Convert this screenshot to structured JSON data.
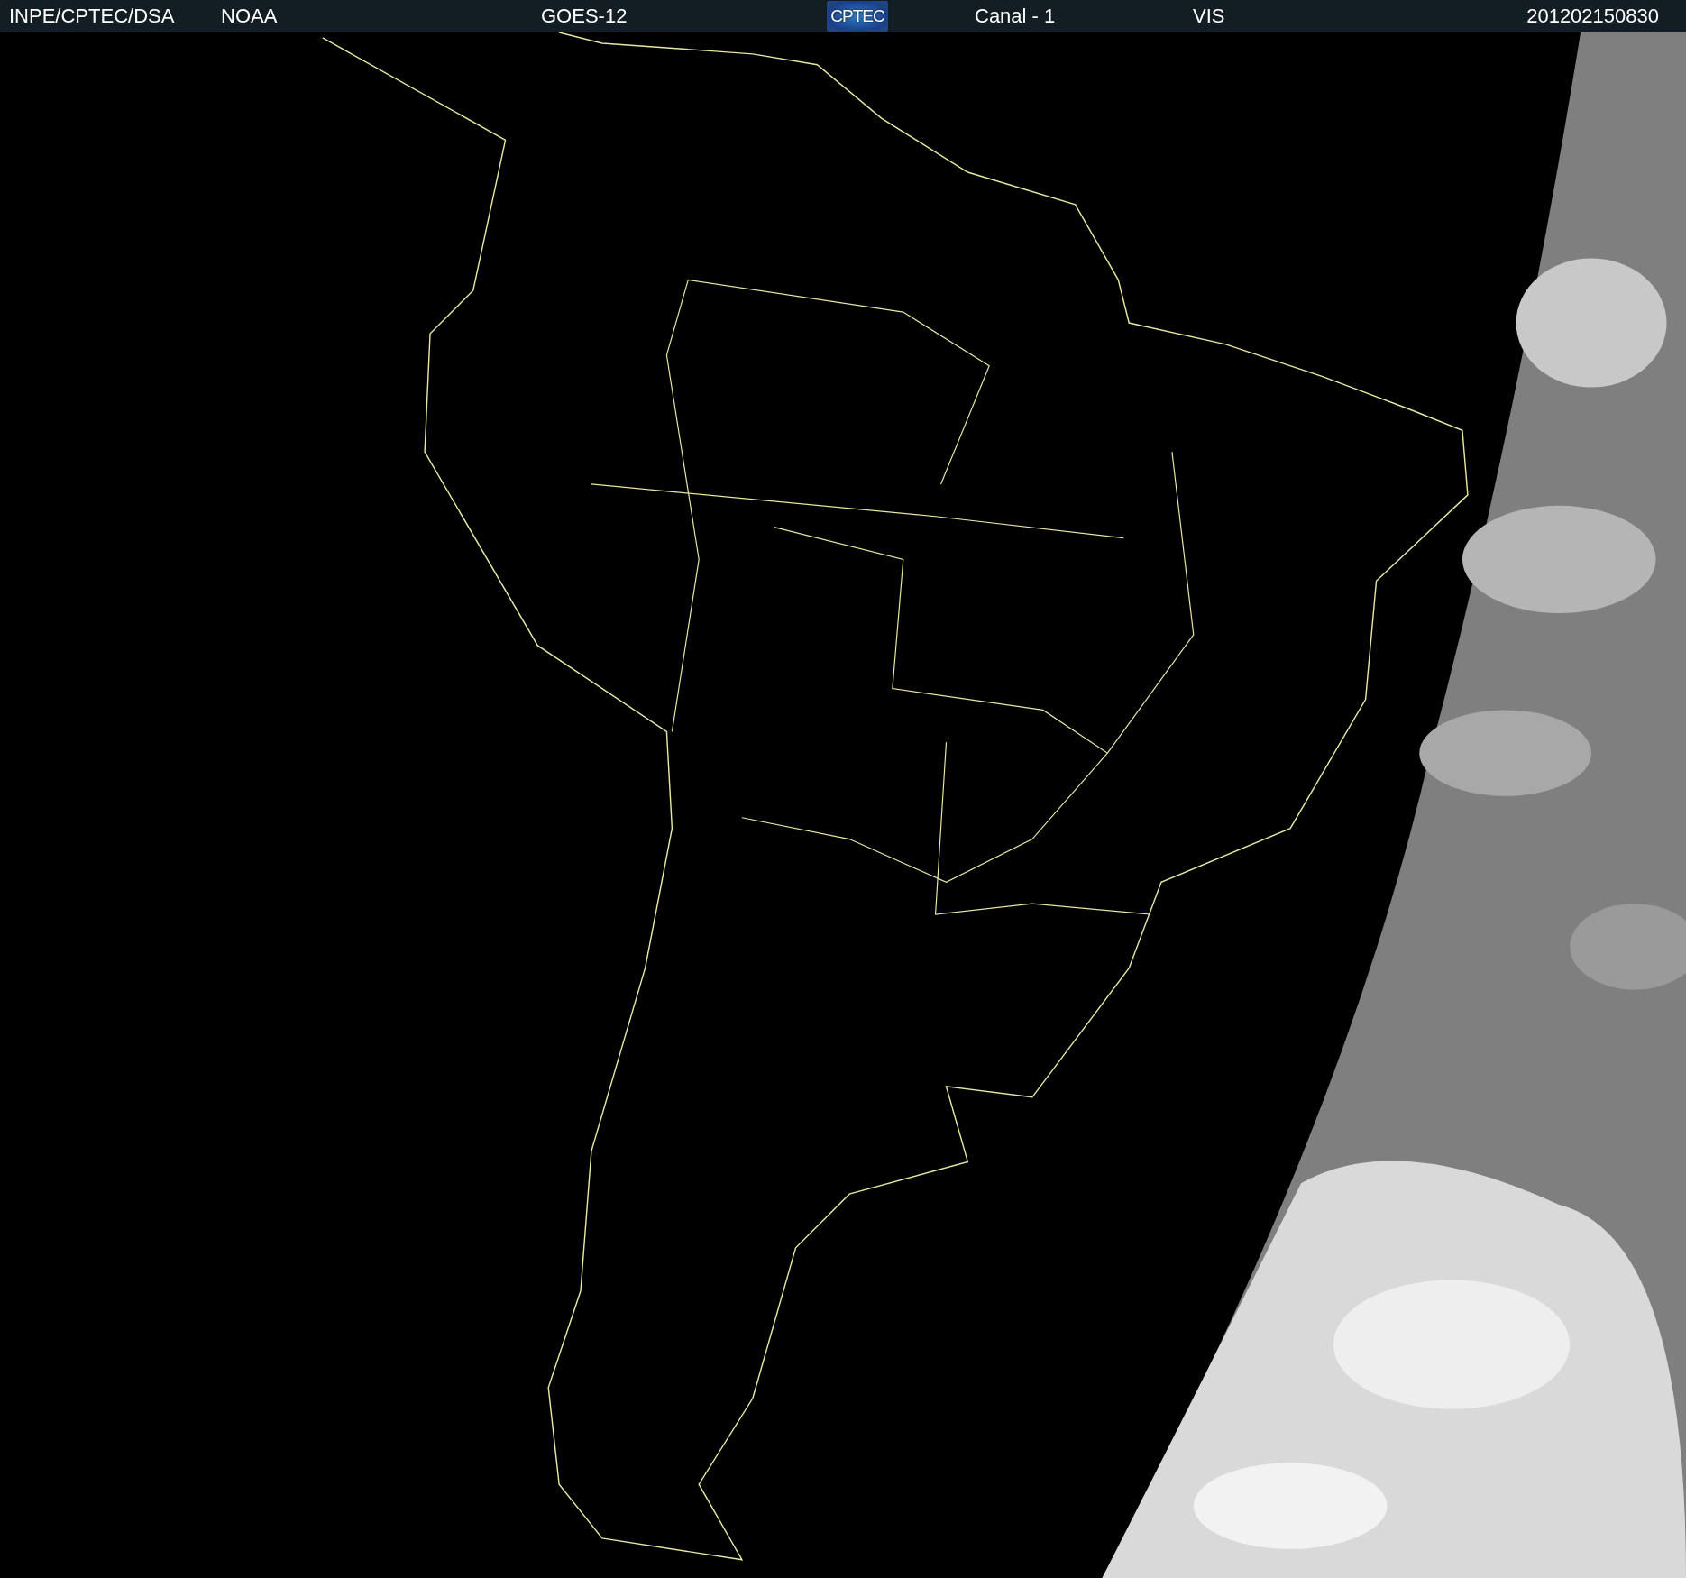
{
  "header": {
    "source": "INPE/CPTEC/DSA",
    "agency": "NOAA",
    "satellite": "GOES-12",
    "logo": "CPTEC",
    "channel": "Canal - 1",
    "band": "VIS",
    "timestamp": "201202150830"
  }
}
